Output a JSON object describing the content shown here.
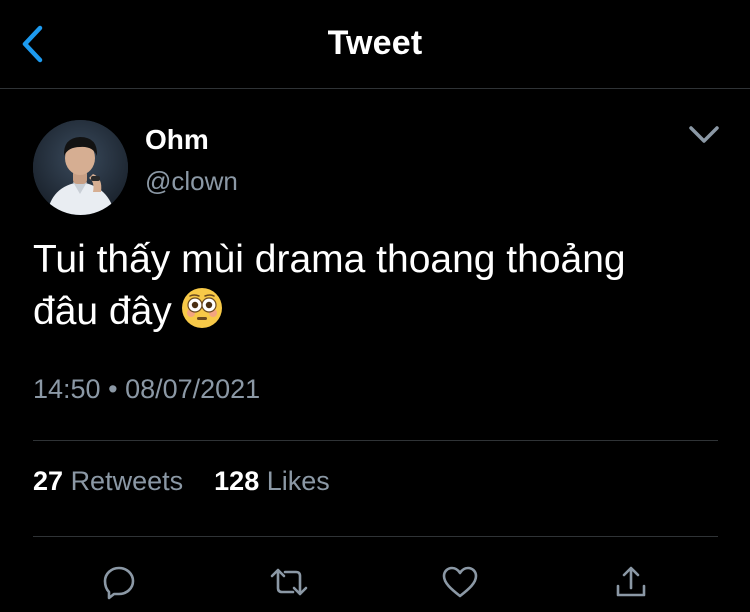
{
  "header": {
    "title": "Tweet",
    "back_icon": "chevron-left-icon",
    "accent": "#1d9bf0"
  },
  "author": {
    "name": "Ohm",
    "handle": "@clown"
  },
  "tweet": {
    "line1": "Tui thấy mùi drama thoang thoảng",
    "line2": "đâu đây",
    "emoji": "flushed-face-emoji"
  },
  "meta": {
    "time": "14:50",
    "separator": "•",
    "date": "08/07/2021"
  },
  "stats": {
    "retweets_count": "27",
    "retweets_label": "Retweets",
    "likes_count": "128",
    "likes_label": "Likes"
  },
  "actions": [
    "reply-icon",
    "retweet-icon",
    "like-icon",
    "share-icon"
  ],
  "colors": {
    "background": "#000000",
    "text": "#ffffff",
    "secondary": "#8b98a5",
    "divider": "#2f3336"
  }
}
